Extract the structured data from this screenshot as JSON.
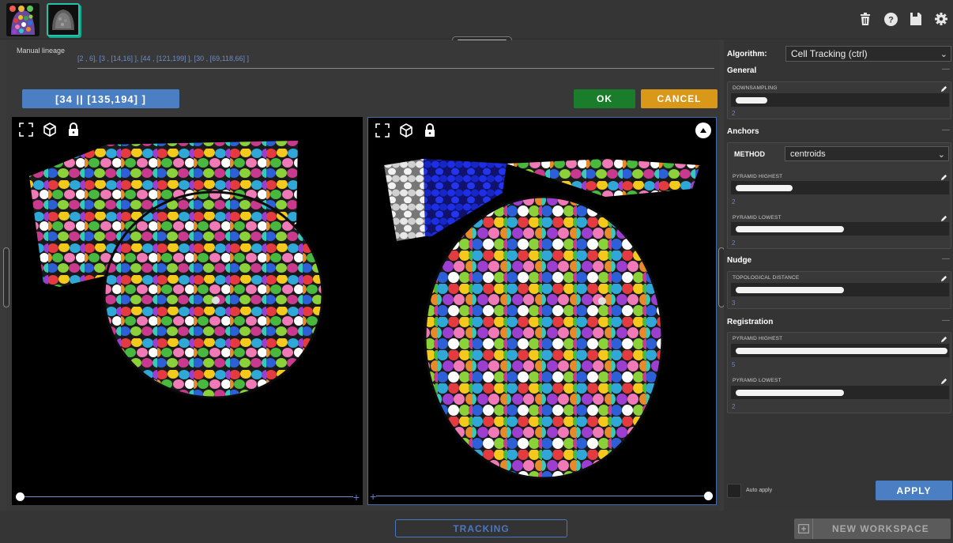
{
  "lineage": {
    "label": "Manual lineage",
    "value": "[2 , 6], [3 , [14,16] ], [44 , [121,199] ], [30 , [69,118,66] ]"
  },
  "selection_button": "[34 || [135,194] ]",
  "ok_label": "OK",
  "cancel_label": "CANCEL",
  "panel": {
    "algorithm_label": "Algorithm:",
    "algorithm_value": "Cell Tracking (ctrl)",
    "sections": {
      "general": "General",
      "anchors": "Anchors",
      "nudge": "Nudge",
      "registration": "Registration"
    },
    "downsampling": {
      "label": "DOWNSAMPLING",
      "value": "2",
      "fill": 0.15
    },
    "method": {
      "label": "METHOD",
      "value": "centroids"
    },
    "anchors_pyramid_highest": {
      "label": "PYRAMID HIGHEST",
      "value": "2",
      "fill": 0.27
    },
    "anchors_pyramid_lowest": {
      "label": "PYRAMID LOWEST",
      "value": "2",
      "fill": 0.51
    },
    "topological_distance": {
      "label": "TOPOLOGICAL DISTANCE",
      "value": "3",
      "fill": 0.51
    },
    "registration_pyramid_highest": {
      "label": "PYRAMID HIGHEST",
      "value": "5",
      "fill": 1.0
    },
    "registration_pyramid_lowest": {
      "label": "PYRAMID LOWEST",
      "value": "2",
      "fill": 0.51
    },
    "auto_apply_label": "Auto apply",
    "apply_label": "APPLY"
  },
  "bottom": {
    "tracking_label": "TRACKING",
    "new_workspace_label": "NEW WORKSPACE"
  },
  "colors": {
    "accent_blue": "#4b7fc4",
    "ok_green": "#1a7d2c",
    "cancel_orange": "#d99818",
    "thumb_teal": "#22c3a8"
  },
  "icons": {
    "top": [
      "trash-icon",
      "help-icon",
      "save-icon",
      "settings-icon"
    ],
    "viewer": [
      "fullscreen-icon",
      "cube-icon",
      "lock-icon"
    ]
  }
}
